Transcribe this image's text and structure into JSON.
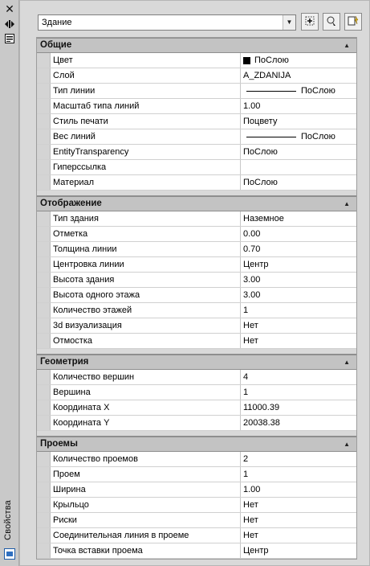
{
  "strip": {
    "icons": [
      "close-icon",
      "autohide-icon",
      "properties-menu-icon"
    ],
    "vertical_label": "Свойства"
  },
  "selector": {
    "value": "Здание",
    "buttons": [
      "toggle-pickadd-icon",
      "select-objects-icon",
      "quick-select-icon"
    ]
  },
  "sections": [
    {
      "title": "Общие",
      "rows": [
        {
          "label": "Цвет",
          "value": "ПоСлою",
          "kind": "color"
        },
        {
          "label": "Слой",
          "value": "A_ZDANIJA"
        },
        {
          "label": "Тип линии",
          "value": "ПоСлою",
          "kind": "line"
        },
        {
          "label": "Масштаб типа линий",
          "value": "1.00"
        },
        {
          "label": "Стиль печати",
          "value": "Поцвету"
        },
        {
          "label": "Вес линий",
          "value": "ПоСлою",
          "kind": "line"
        },
        {
          "label": "EntityTransparency",
          "value": "ПоСлою"
        },
        {
          "label": "Гиперссылка",
          "value": ""
        },
        {
          "label": "Материал",
          "value": "ПоСлою"
        }
      ]
    },
    {
      "title": "Отображение",
      "rows": [
        {
          "label": "Тип здания",
          "value": "Наземное"
        },
        {
          "label": "Отметка",
          "value": "0.00"
        },
        {
          "label": "Толщина линии",
          "value": "0.70"
        },
        {
          "label": "Центровка линии",
          "value": "Центр"
        },
        {
          "label": "Высота здания",
          "value": "3.00"
        },
        {
          "label": "Высота одного этажа",
          "value": "3.00"
        },
        {
          "label": "Количество этажей",
          "value": "1"
        },
        {
          "label": "3d визуализация",
          "value": "Нет"
        },
        {
          "label": "Отмостка",
          "value": "Нет"
        }
      ]
    },
    {
      "title": "Геометрия",
      "rows": [
        {
          "label": "Количество вершин",
          "value": "4"
        },
        {
          "label": "Вершина",
          "value": "1"
        },
        {
          "label": "Координата X",
          "value": "11000.39"
        },
        {
          "label": "Координата Y",
          "value": "20038.38"
        }
      ]
    },
    {
      "title": "Проемы",
      "rows": [
        {
          "label": "Количество проемов",
          "value": "2"
        },
        {
          "label": "Проем",
          "value": "1"
        },
        {
          "label": "Ширина",
          "value": "1.00"
        },
        {
          "label": "Крыльцо",
          "value": "Нет"
        },
        {
          "label": "Риски",
          "value": "Нет"
        },
        {
          "label": "Соединительная линия в проеме",
          "value": "Нет"
        },
        {
          "label": "Точка вставки проема",
          "value": "Центр"
        }
      ]
    }
  ]
}
